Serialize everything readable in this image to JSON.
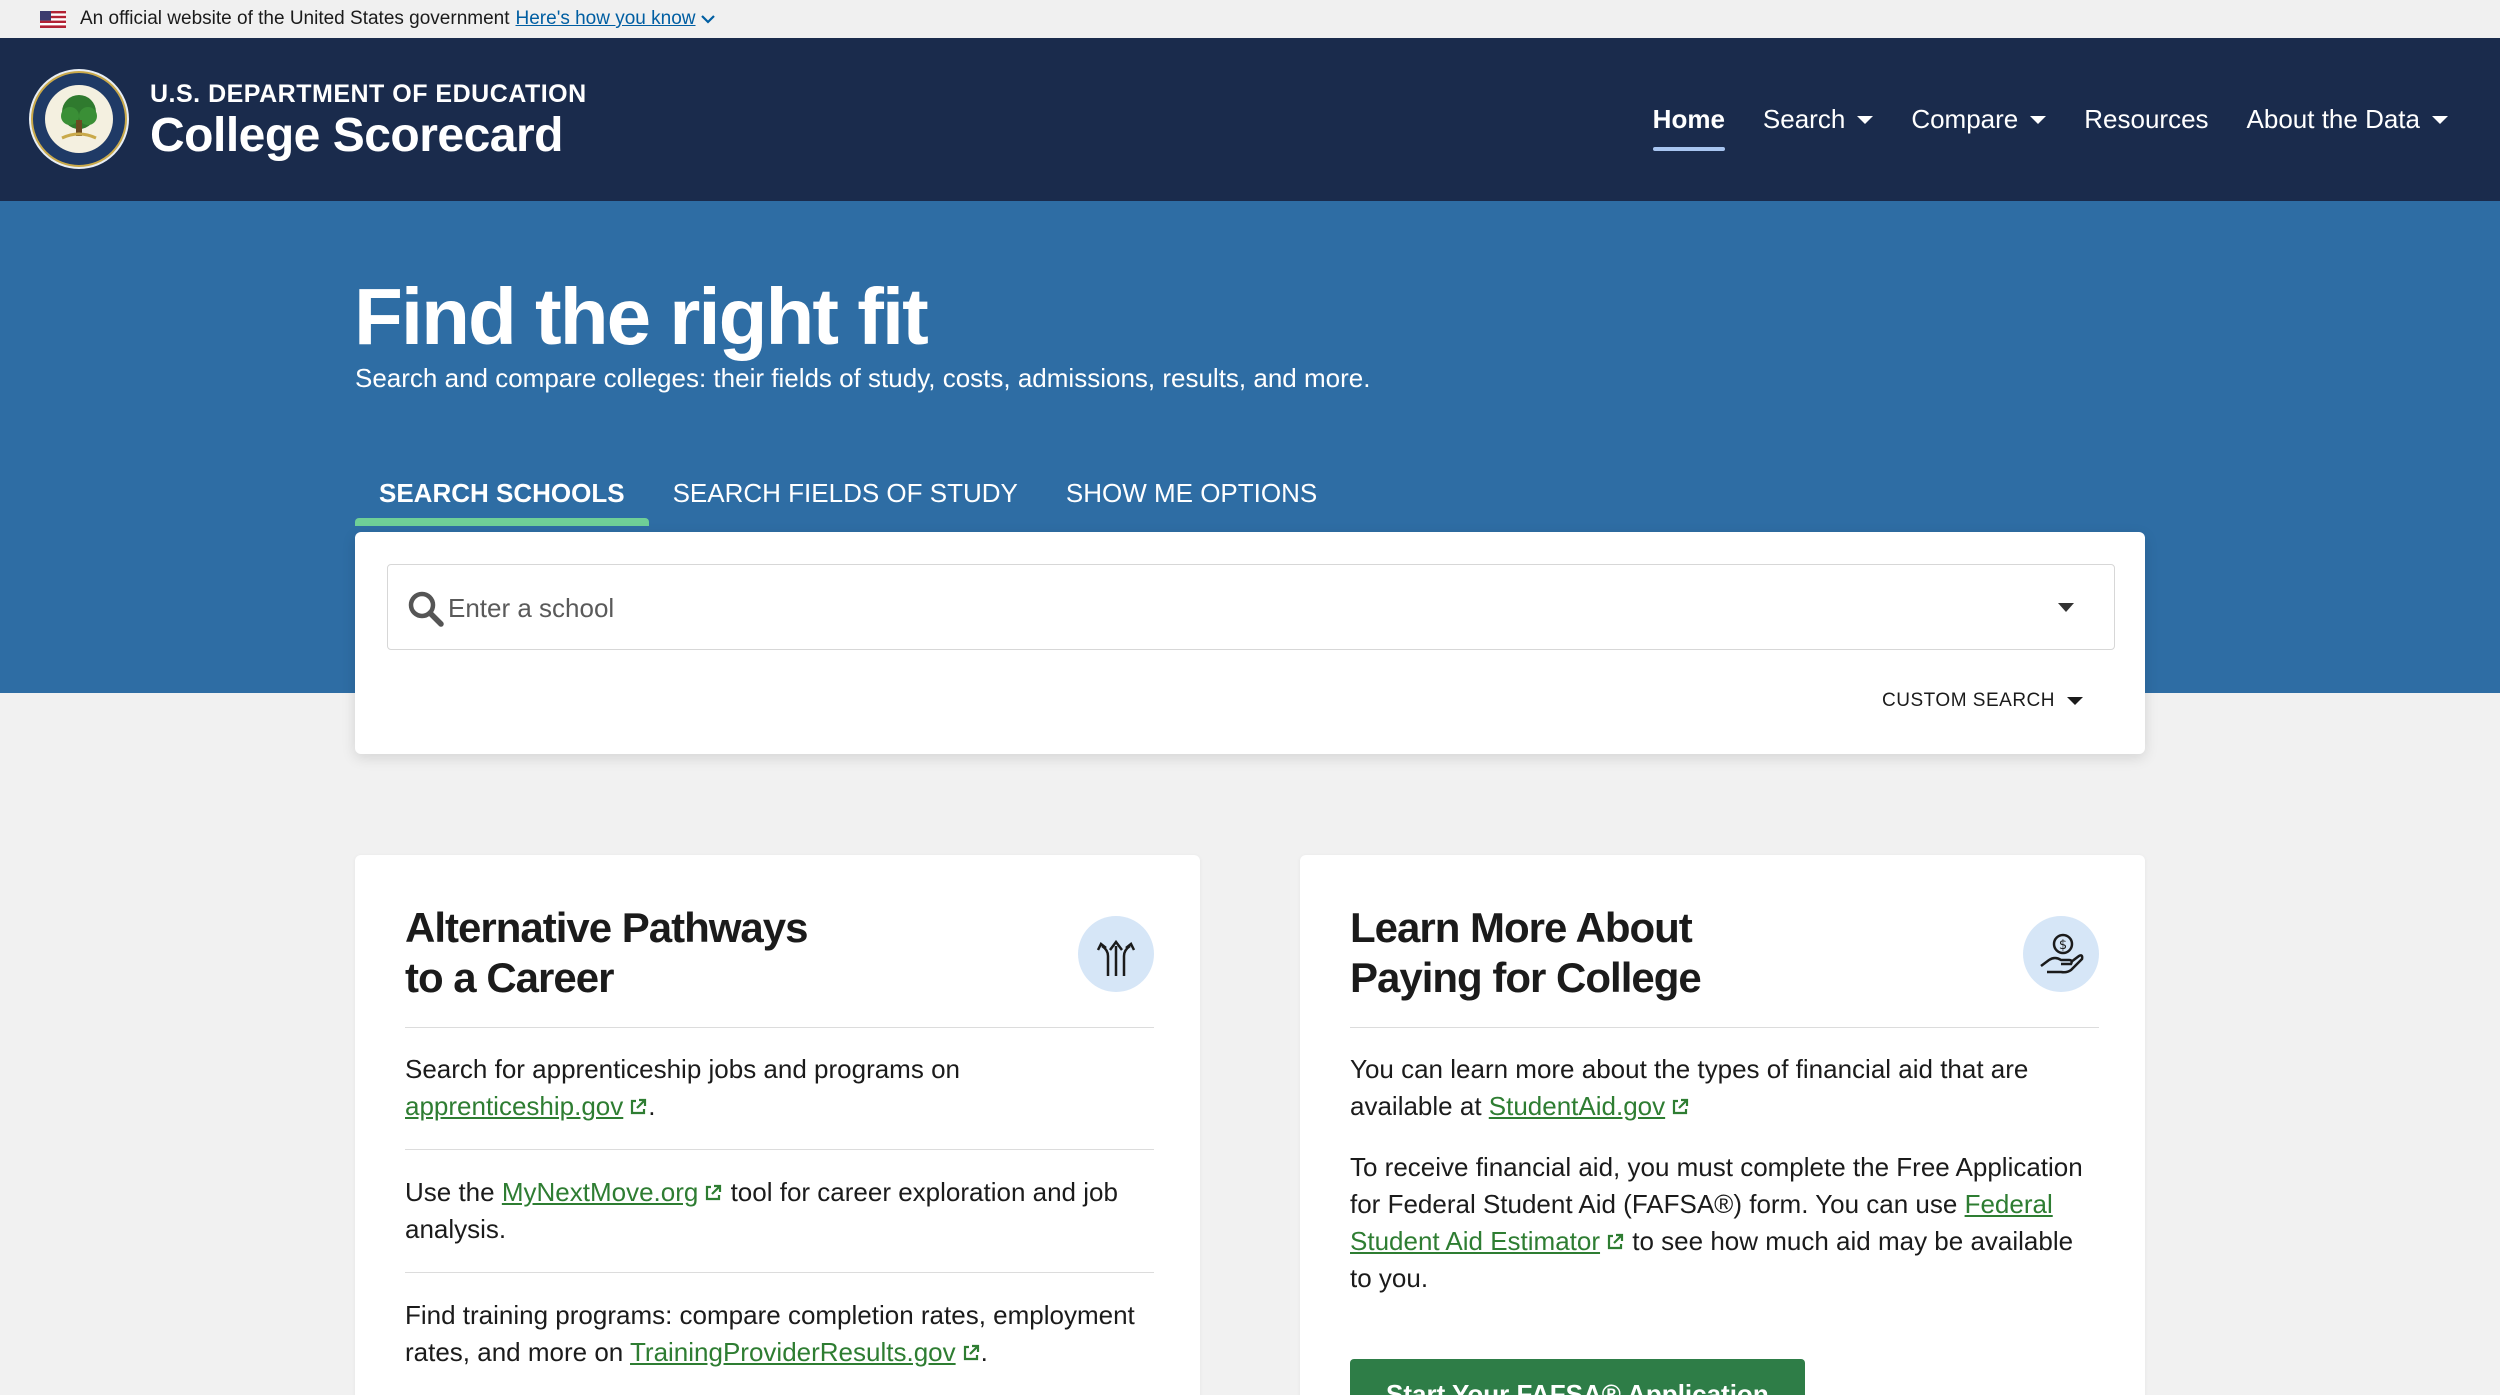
{
  "gov_banner": {
    "text": "An official website of the United States government",
    "link": "Here's how you know"
  },
  "header": {
    "department": "U.S. DEPARTMENT OF EDUCATION",
    "title": "College Scorecard",
    "nav": [
      {
        "label": "Home",
        "active": true,
        "dropdown": false
      },
      {
        "label": "Search",
        "active": false,
        "dropdown": true
      },
      {
        "label": "Compare",
        "active": false,
        "dropdown": true
      },
      {
        "label": "Resources",
        "active": false,
        "dropdown": false
      },
      {
        "label": "About the Data",
        "active": false,
        "dropdown": true
      }
    ]
  },
  "hero": {
    "title": "Find the right fit",
    "subtitle": "Search and compare colleges: their fields of study, costs, admissions, results, and more.",
    "tabs": [
      {
        "label": "SEARCH SCHOOLS",
        "active": true
      },
      {
        "label": "SEARCH FIELDS OF STUDY",
        "active": false
      },
      {
        "label": "SHOW ME OPTIONS",
        "active": false
      }
    ]
  },
  "search": {
    "placeholder": "Enter a school",
    "custom_search": "CUSTOM SEARCH"
  },
  "cards": {
    "pathways": {
      "title_line1": "Alternative Pathways",
      "title_line2": "to a Career",
      "p1_text": "Search for apprenticeship jobs and programs on",
      "p1_link": "apprenticeship.gov",
      "p1_end": ".",
      "p2_start": "Use the",
      "p2_link": "MyNextMove.org",
      "p2_end": "tool for career exploration and job analysis.",
      "p3_text": "Find training programs: compare completion rates, employment rates, and more on",
      "p3_link": "TrainingProviderResults.gov",
      "p3_end": "."
    },
    "paying": {
      "title_line1": "Learn More About",
      "title_line2": "Paying for College",
      "p1_text": "You can learn more about the types of financial aid that are available at",
      "p1_link": "StudentAid.gov",
      "p2_text": "To receive financial aid, you must complete the Free Application for Federal Student Aid (FAFSA®) form. You can use",
      "p2_link": "Federal Student Aid Estimator",
      "p2_end": "to see how much aid may be available to you.",
      "button": "Start Your FAFSA® Application"
    }
  },
  "colors": {
    "header_bg": "#1a2b4c",
    "hero_bg": "#2e6da4",
    "tab_indicator": "#6fcf97",
    "link_green": "#2e7d32",
    "button_green": "#2e7d47"
  }
}
